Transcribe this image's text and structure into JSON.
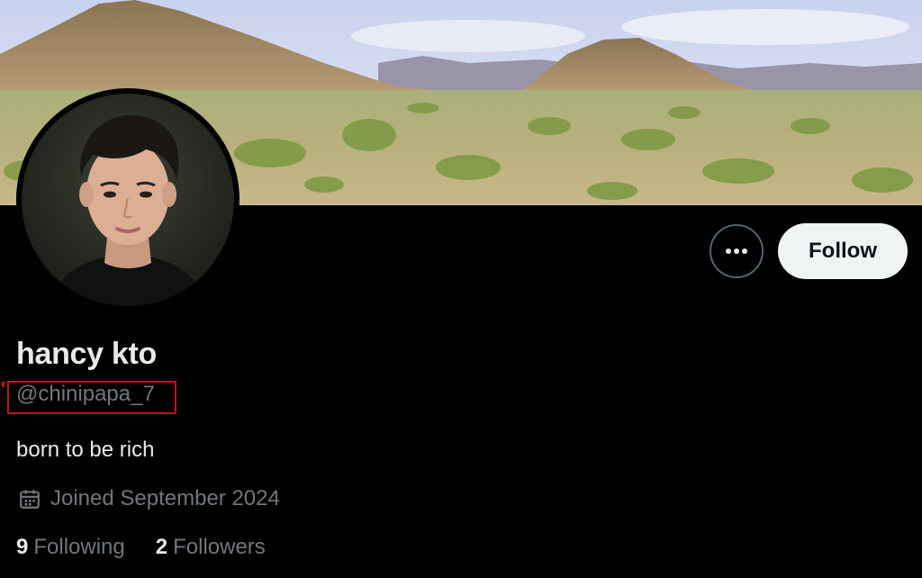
{
  "profile": {
    "display_name": "hancy kto",
    "handle": "@chinipapa_7",
    "bio": "born to be rich",
    "joined": "Joined September 2024",
    "following_count": "9",
    "following_label": "Following",
    "followers_count": "2",
    "followers_label": "Followers"
  },
  "actions": {
    "more_icon": "more-horizontal-icon",
    "follow_label": "Follow"
  },
  "icons": {
    "calendar": "calendar-icon"
  },
  "colors": {
    "background": "#000000",
    "primary_text": "#e7e9ea",
    "secondary_text": "#71767b",
    "follow_button_bg": "#eff3f4",
    "highlight_box": "#c0171b"
  }
}
